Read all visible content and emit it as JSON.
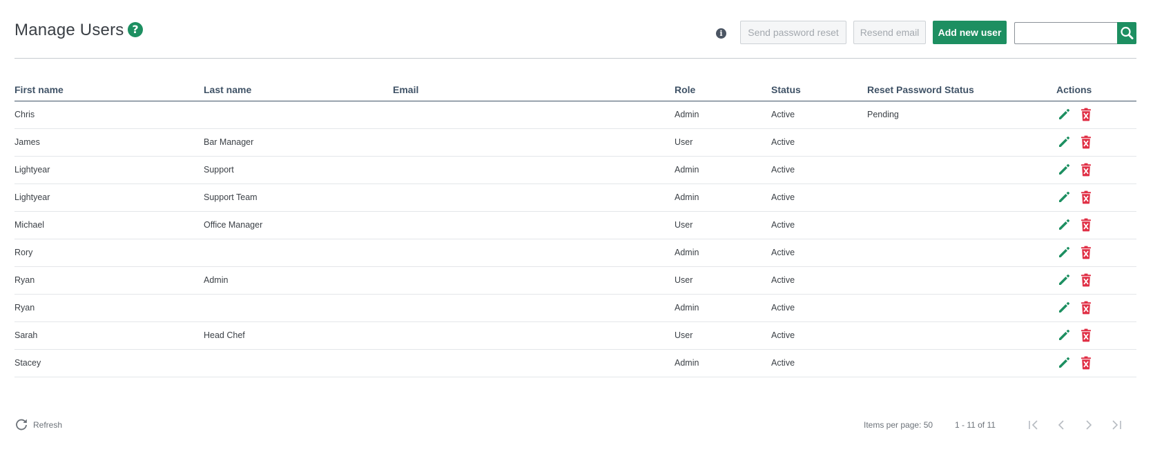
{
  "header": {
    "title": "Manage Users",
    "help_icon": "help-circle-icon",
    "info_icon": "info-circle-icon",
    "buttons": {
      "send_password_reset": "Send password reset",
      "resend_email": "Resend email",
      "add_new_user": "Add new user"
    },
    "search": {
      "value": "",
      "placeholder": "",
      "icon": "search-icon"
    }
  },
  "table": {
    "columns": {
      "first_name": "First name",
      "last_name": "Last name",
      "email": "Email",
      "role": "Role",
      "status": "Status",
      "reset_password_status": "Reset Password Status",
      "actions": "Actions"
    },
    "rows": [
      {
        "first_name": "Chris",
        "last_name": "",
        "email": "",
        "role": "Admin",
        "status": "Active",
        "reset_password_status": "Pending"
      },
      {
        "first_name": "James",
        "last_name": "Bar Manager",
        "email": "",
        "role": "User",
        "status": "Active",
        "reset_password_status": ""
      },
      {
        "first_name": "Lightyear",
        "last_name": "Support",
        "email": "",
        "role": "Admin",
        "status": "Active",
        "reset_password_status": ""
      },
      {
        "first_name": "Lightyear",
        "last_name": "Support Team",
        "email": "",
        "role": "Admin",
        "status": "Active",
        "reset_password_status": ""
      },
      {
        "first_name": "Michael",
        "last_name": "Office Manager",
        "email": "",
        "role": "User",
        "status": "Active",
        "reset_password_status": ""
      },
      {
        "first_name": "Rory",
        "last_name": "",
        "email": "",
        "role": "Admin",
        "status": "Active",
        "reset_password_status": ""
      },
      {
        "first_name": "Ryan",
        "last_name": "Admin",
        "email": "",
        "role": "User",
        "status": "Active",
        "reset_password_status": ""
      },
      {
        "first_name": "Ryan",
        "last_name": "",
        "email": "",
        "role": "Admin",
        "status": "Active",
        "reset_password_status": ""
      },
      {
        "first_name": "Sarah",
        "last_name": "Head Chef",
        "email": "",
        "role": "User",
        "status": "Active",
        "reset_password_status": ""
      },
      {
        "first_name": "Stacey",
        "last_name": "",
        "email": "",
        "role": "Admin",
        "status": "Active",
        "reset_password_status": ""
      }
    ],
    "row_action_icons": [
      "edit-pencil-icon",
      "delete-trash-icon"
    ]
  },
  "footer": {
    "refresh_label": "Refresh",
    "items_per_page": "Items per page: 50",
    "range": "1 - 11 of 11",
    "pager_icons": [
      "first-page-icon",
      "previous-page-icon",
      "next-page-icon",
      "last-page-icon"
    ]
  },
  "colors": {
    "primary_green": "#1d8f61",
    "delete_red": "#e02f45",
    "header_text": "#3f5266",
    "disabled_text": "#a3a8ae"
  }
}
